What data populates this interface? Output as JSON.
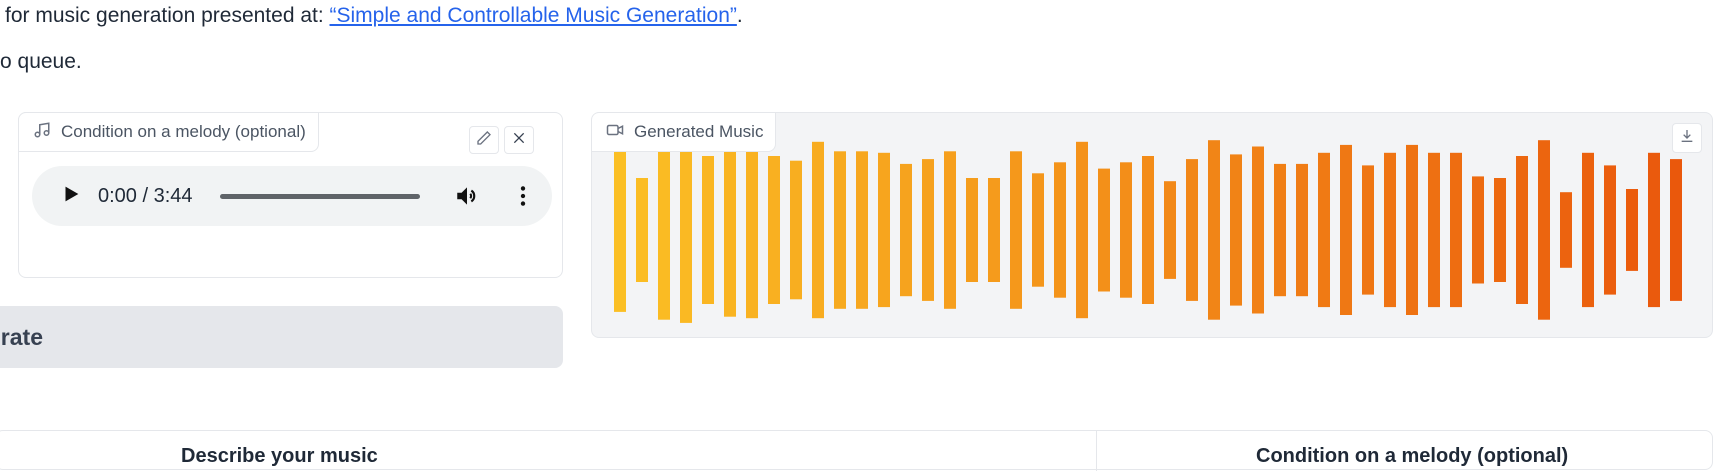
{
  "intro": {
    "line1_prefix": "for music generation presented at: ",
    "line1_link": "“Simple and Controllable Music Generation”",
    "line1_suffix": ".",
    "line2": "o queue."
  },
  "melody": {
    "label": "Condition on a melody (optional)",
    "label_icon": "music-note-icon",
    "time": "0:00 / 3:44",
    "progress": 0
  },
  "generate": {
    "label": "erate"
  },
  "generated_music": {
    "label": "Generated Music",
    "label_icon": "video-camera-icon",
    "bar_levels": [
      0.52,
      0.33,
      0.57,
      0.59,
      0.47,
      0.55,
      0.56,
      0.47,
      0.44,
      0.56,
      0.5,
      0.5,
      0.49,
      0.42,
      0.45,
      0.5,
      0.33,
      0.33,
      0.5,
      0.36,
      0.43,
      0.56,
      0.39,
      0.43,
      0.47,
      0.31,
      0.45,
      0.57,
      0.48,
      0.53,
      0.42,
      0.42,
      0.49,
      0.54,
      0.41,
      0.49,
      0.54,
      0.49,
      0.49,
      0.34,
      0.33,
      0.47,
      0.57,
      0.24,
      0.49,
      0.41,
      0.26,
      0.49,
      0.45
    ],
    "color_start": "#fbbf24",
    "color_end": "#ea580c"
  },
  "bottom_tabs": {
    "left": "Describe your music",
    "right": "Condition on a melody (optional)"
  }
}
